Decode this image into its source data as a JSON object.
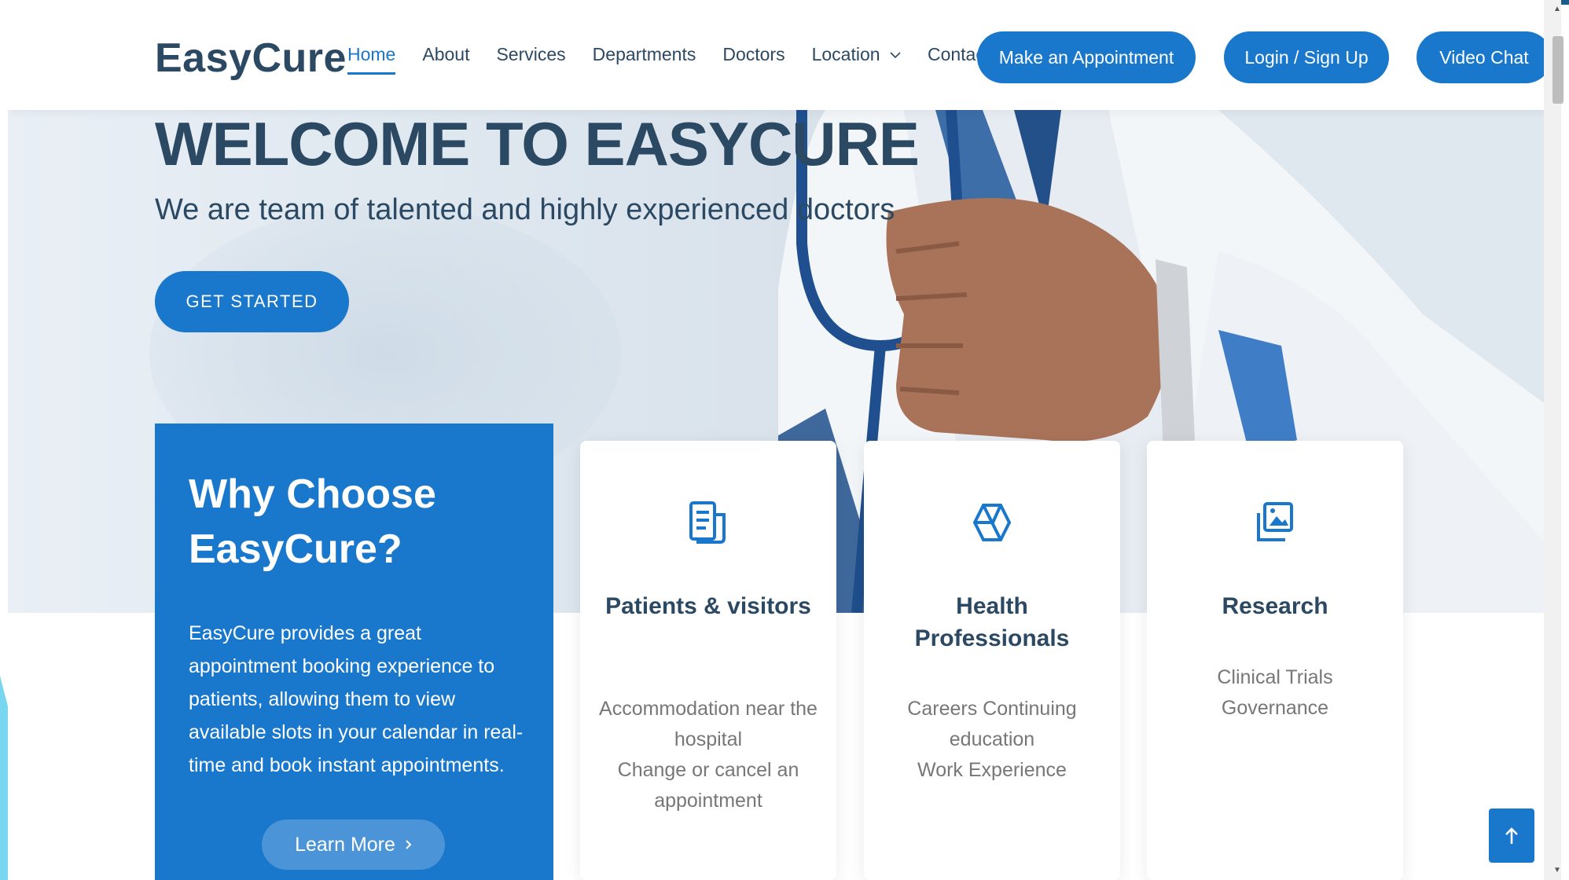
{
  "brand": {
    "logo": "EasyCure",
    "accent_color": "#1977cc",
    "heading_color": "#2c4964"
  },
  "nav": {
    "items": [
      {
        "label": "Home",
        "active": true
      },
      {
        "label": "About"
      },
      {
        "label": "Services"
      },
      {
        "label": "Departments"
      },
      {
        "label": "Doctors"
      },
      {
        "label": "Location",
        "dropdown": true
      },
      {
        "label": "Contact"
      }
    ]
  },
  "header_buttons": {
    "appointment": "Make an Appointment",
    "login": "Login / Sign Up",
    "video": "Video Chat"
  },
  "hero": {
    "title": "WELCOME TO EASYCURE",
    "subtitle": "We are team of talented and highly experienced doctors",
    "cta": "GET STARTED",
    "image": "doctor-with-stethoscope"
  },
  "why": {
    "title": "Why Choose EasyCure?",
    "text": "EasyCure provides a great appointment booking experience to patients, allowing them to view available slots in your calendar in real-time and book instant appointments.",
    "button": "Learn More",
    "button_icon": "chevron-right-icon"
  },
  "cards": [
    {
      "icon": "document-icon",
      "title": "Patients & visitors",
      "lines": [
        "Accommodation near the hospital",
        "Change or cancel an appointment"
      ]
    },
    {
      "icon": "hexagon-icon",
      "title": "Health Professionals",
      "lines": [
        "Careers Continuing education",
        "Work Experience"
      ]
    },
    {
      "icon": "images-icon",
      "title": "Research",
      "lines": [
        "Clinical Trials Governance"
      ]
    }
  ],
  "back_to_top": {
    "icon": "arrow-up-icon"
  }
}
